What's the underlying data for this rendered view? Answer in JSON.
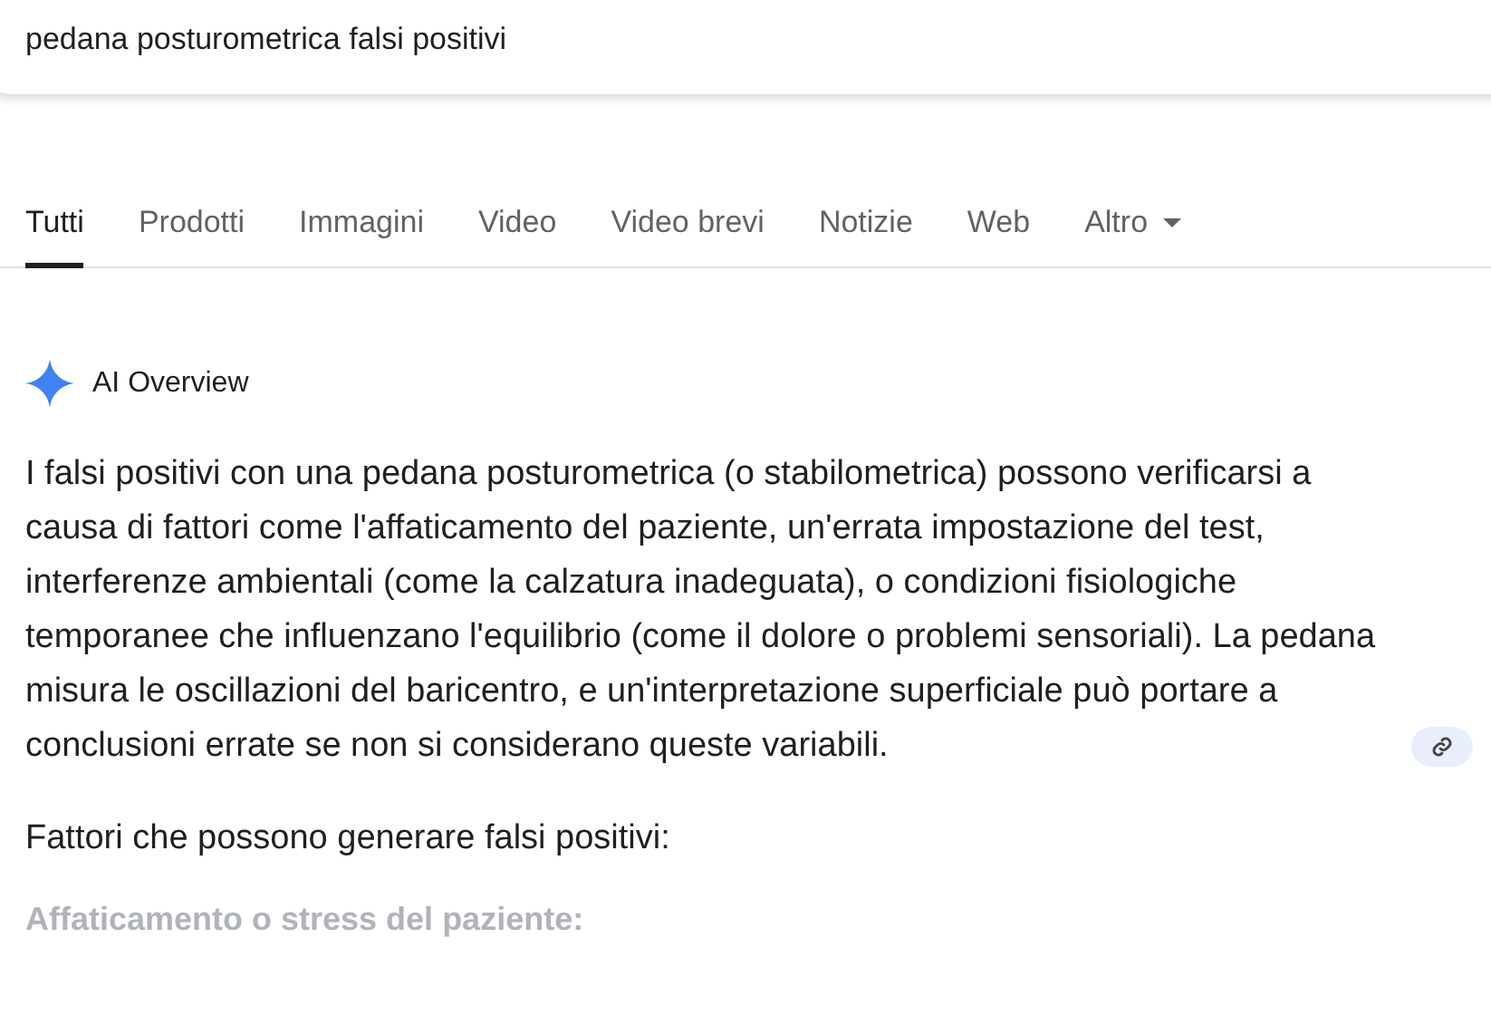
{
  "search": {
    "value": "pedana posturometrica falsi positivi"
  },
  "tabs": [
    {
      "label": "Tutti",
      "selected": true
    },
    {
      "label": "Prodotti",
      "selected": false
    },
    {
      "label": "Immagini",
      "selected": false
    },
    {
      "label": "Video",
      "selected": false
    },
    {
      "label": "Video brevi",
      "selected": false
    },
    {
      "label": "Notizie",
      "selected": false
    },
    {
      "label": "Web",
      "selected": false
    },
    {
      "label": "Altro",
      "selected": false,
      "kind": "menu"
    }
  ],
  "ai_overview": {
    "title": "AI Overview",
    "summary": "I falsi positivi con una pedana posturometrica (o stabilometrica) possono verificarsi a causa di fattori come l'affaticamento del paziente, un'errata impostazione del test, interferenze ambientali (come la calzatura inadeguata), o condizioni fisiologiche temporanee che influenzano l'equilibrio (come il dolore o problemi sensoriali). La pedana misura le oscillazioni del baricentro, e un'interpretazione superficiale può portare a conclusioni errate se non si considerano queste variabili.",
    "heading": "Fattori che possono generare falsi positivi:",
    "subheading": "Affaticamento o stress del paziente:"
  }
}
